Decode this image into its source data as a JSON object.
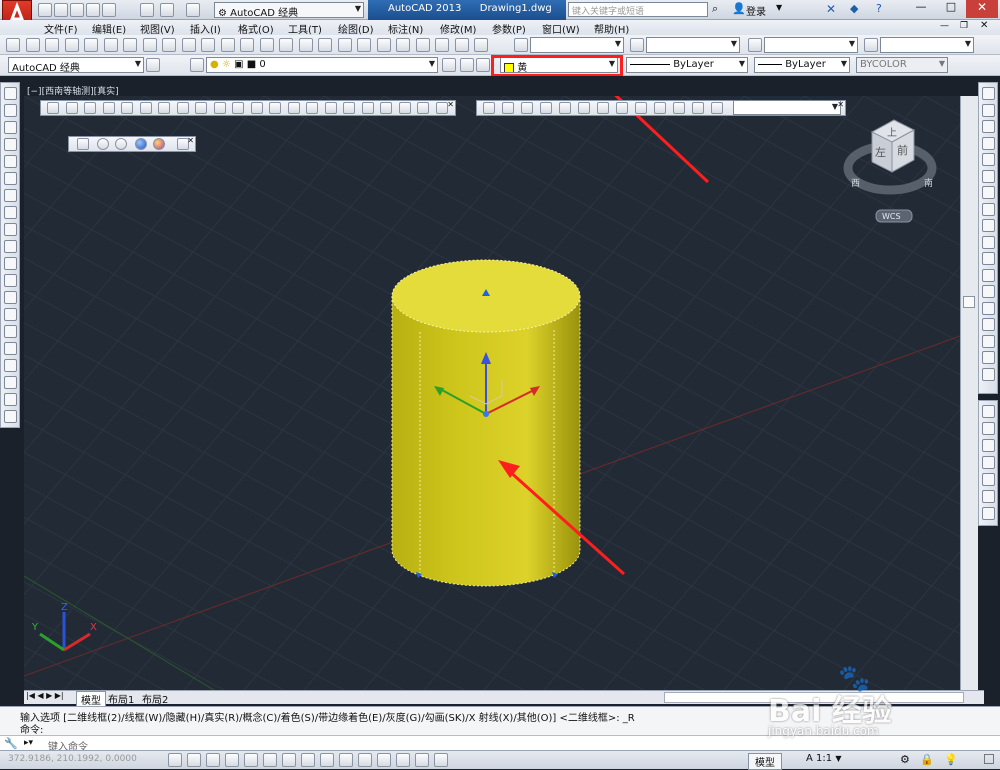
{
  "titlebar": {
    "workspace": "AutoCAD 经典",
    "app_title": "AutoCAD 2013",
    "file_name": "Drawing1.dwg",
    "search_placeholder": "键入关键字或短语",
    "login": "登录"
  },
  "menu": [
    "文件(F)",
    "编辑(E)",
    "视图(V)",
    "插入(I)",
    "格式(O)",
    "工具(T)",
    "绘图(D)",
    "标注(N)",
    "修改(M)",
    "参数(P)",
    "窗口(W)",
    "帮助(H)"
  ],
  "props": {
    "workspace_combo": "AutoCAD 经典",
    "layer": "0",
    "color": "黄",
    "color_hex": "#ffff00",
    "linetype": "ByLayer",
    "lineweight": "ByLayer",
    "plotstyle": "BYCOLOR"
  },
  "viewport": {
    "label": "[−][西南等轴测][真实]",
    "background": "#222a35",
    "cylinder_color": "#c9c21a",
    "annotation_color": "#ff1e1e"
  },
  "viewcube": {
    "top": "上",
    "front": "前",
    "left": "左",
    "compass_west": "西",
    "compass_south": "南",
    "wcs": "WCS"
  },
  "ucs": {
    "x": "X",
    "y": "Y",
    "z": "Z"
  },
  "tabs": [
    "模型",
    "布局1",
    "布局2"
  ],
  "command": {
    "history": "输入选项 [二维线框(2)/线框(W)/隐藏(H)/真实(R)/概念(C)/着色(S)/带边缘着色(E)/灰度(G)/勾画(SK)/X 射线(X)/其他(O)] <二维线框>: _R",
    "prompt_label": "命令:",
    "input_placeholder": "键入命令"
  },
  "status": {
    "coords": "372.9186, 210.1992, 0.0000",
    "model": "模型",
    "scale": "1:1"
  },
  "watermark": {
    "brand": "Bai  经验",
    "url": "jingyan.baidu.com"
  }
}
